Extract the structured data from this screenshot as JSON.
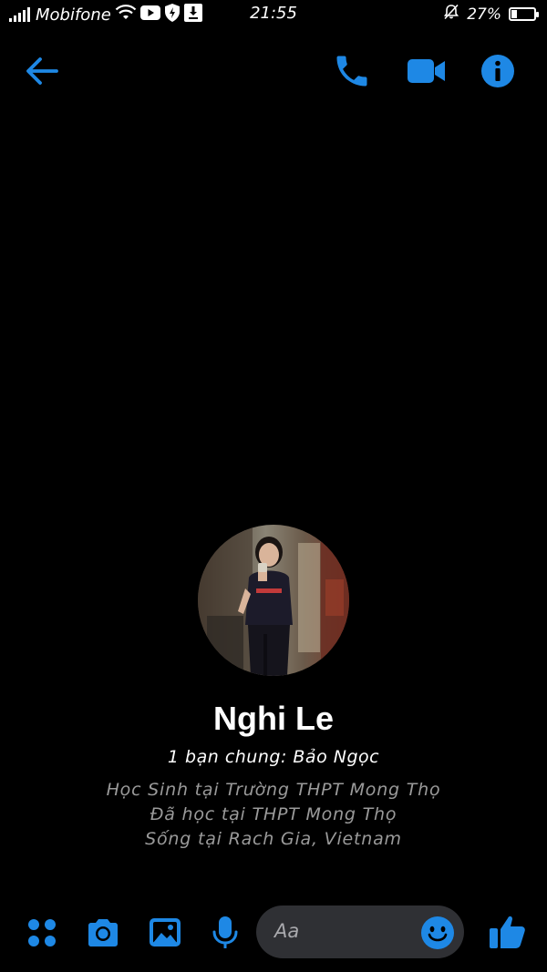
{
  "status_bar": {
    "carrier": "Mobifone",
    "time": "21:55",
    "battery_text": "27%",
    "battery_level": 0.27,
    "icons": [
      "signal-icon",
      "wifi-icon",
      "youtube-icon",
      "shield-icon",
      "download-icon",
      "silent-bell-icon",
      "battery-icon"
    ]
  },
  "header": {
    "icons": [
      "back-arrow-icon",
      "phone-icon",
      "video-camera-icon",
      "info-icon"
    ]
  },
  "profile": {
    "name": "Nghi Le",
    "mutual_friends": "1 bạn chung: Bảo Ngọc",
    "details": [
      "Học Sinh tại Trường THPT Mong Thọ",
      "Đã học tại THPT Mong Thọ",
      "Sống tại Rach Gia, Vietnam"
    ]
  },
  "composer": {
    "placeholder": "Aa",
    "icons": [
      "more-dots-icon",
      "camera-icon",
      "gallery-icon",
      "microphone-icon",
      "emoji-icon",
      "thumbs-up-icon"
    ]
  },
  "colors": {
    "background": "#000000",
    "accent": "#1e88e5",
    "muted_text": "#9a9a9a",
    "input_bg": "#2f3034"
  }
}
